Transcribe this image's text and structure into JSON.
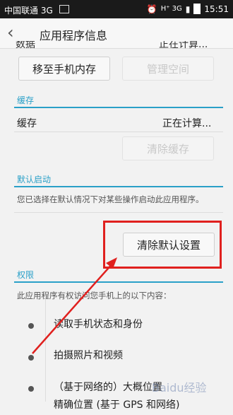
{
  "status_bar": {
    "carrier": "中国联通 3G",
    "network": "H⁺ 3G",
    "time": "15:51"
  },
  "title_bar": {
    "back_icon": "back-chevron-icon",
    "title": "应用程序信息"
  },
  "storage": {
    "truncated_label": "数据",
    "truncated_value": "正在计算...",
    "move_button": "移至手机内存",
    "manage_button": "管理空间"
  },
  "cache": {
    "header": "缓存",
    "label": "缓存",
    "value": "正在计算...",
    "clear_button": "清除缓存"
  },
  "default_launch": {
    "header": "默认启动",
    "description": "您已选择在默认情况下对某些操作启动此应用程序。",
    "clear_button": "清除默认设置"
  },
  "permissions": {
    "header": "权限",
    "description": "此应用程序有权访问您手机上的以下内容：",
    "items": [
      "读取手机状态和身份",
      "拍摄照片和视频",
      "（基于网络的）大概位置",
      "精确位置 (基于 GPS 和网络)"
    ]
  },
  "colors": {
    "accent": "#2aa0c8",
    "highlight": "#e0201e"
  },
  "watermark": "Baidu经验"
}
